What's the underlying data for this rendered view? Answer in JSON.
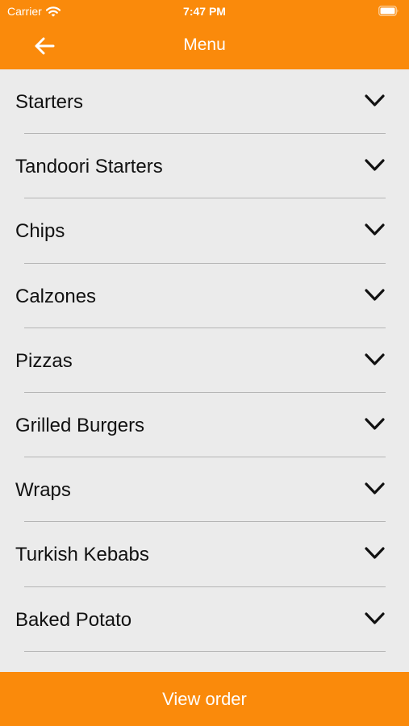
{
  "status_bar": {
    "carrier": "Carrier",
    "time": "7:47 PM",
    "icons": [
      "wifi-icon",
      "battery-icon"
    ]
  },
  "nav": {
    "title": "Menu",
    "back_icon": "arrow-left-icon"
  },
  "menu": {
    "items": [
      {
        "label": "Starters"
      },
      {
        "label": "Tandoori Starters"
      },
      {
        "label": "Chips"
      },
      {
        "label": "Calzones"
      },
      {
        "label": "Pizzas"
      },
      {
        "label": "Grilled Burgers"
      },
      {
        "label": "Wraps"
      },
      {
        "label": "Turkish Kebabs"
      },
      {
        "label": "Baked Potato"
      }
    ],
    "expand_icon": "chevron-down-icon"
  },
  "footer": {
    "view_order_label": "View order"
  },
  "colors": {
    "brand": "#fa8a0b",
    "background": "#ebebeb",
    "text": "#111111",
    "divider": "#b5b5b5"
  }
}
